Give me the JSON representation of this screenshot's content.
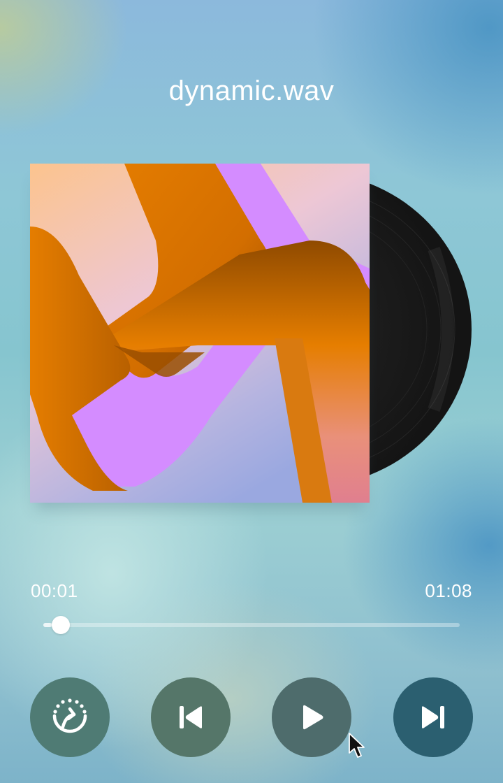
{
  "player": {
    "track_title": "dynamic.wav",
    "time_current": "00:01",
    "time_total": "01:08",
    "progress_fraction": 0.02
  },
  "controls": [
    {
      "name": "share-button",
      "icon": "share-arrow-icon"
    },
    {
      "name": "previous-track-button",
      "icon": "skip-previous-icon"
    },
    {
      "name": "play-button",
      "icon": "play-icon"
    },
    {
      "name": "next-track-button",
      "icon": "skip-next-icon"
    }
  ],
  "colors": {
    "text": "#ffffff",
    "album_orange": "#e57d00",
    "album_purple": "#d48cff",
    "vinyl": "#1a1a1a"
  }
}
